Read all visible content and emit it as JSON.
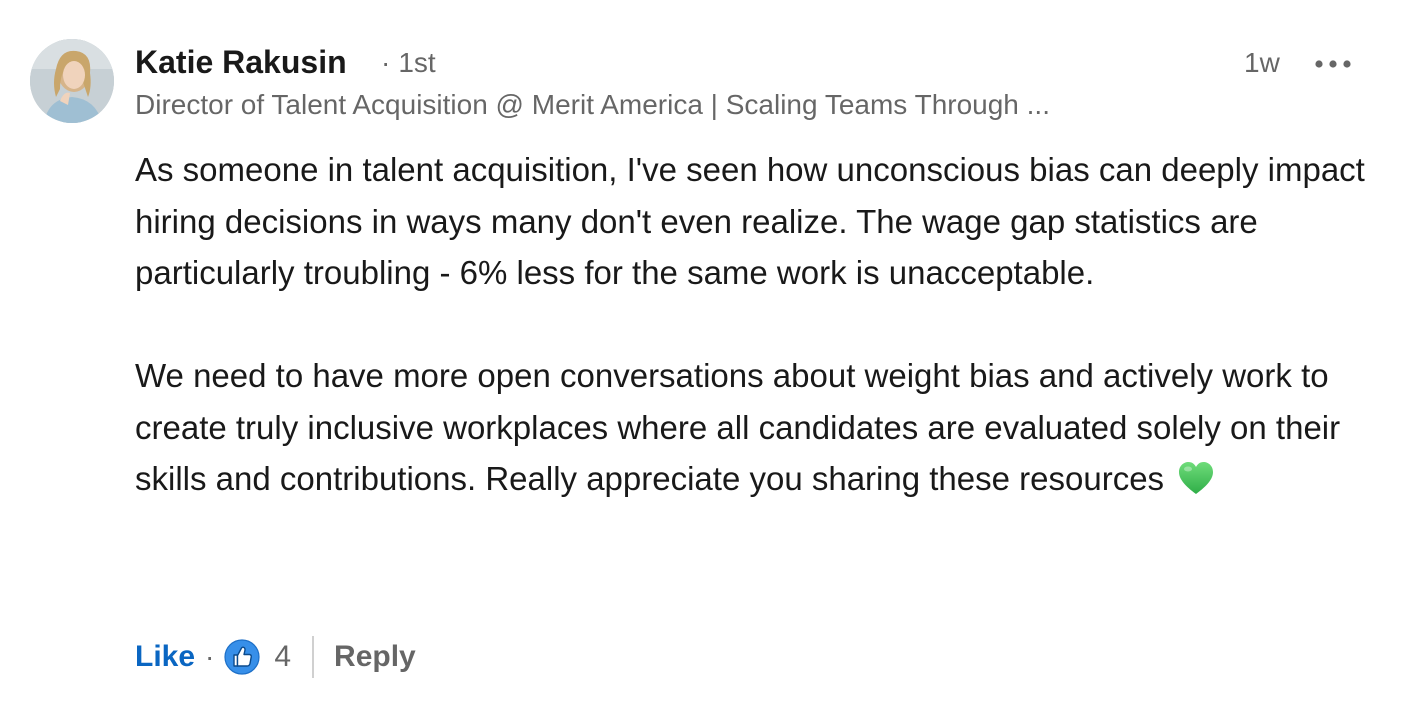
{
  "comment": {
    "author": {
      "name": "Katie Rakusin",
      "connection_degree": "1st",
      "separator": "·",
      "headline": "Director of Talent Acquisition @ Merit America | Scaling Teams Through ..."
    },
    "timestamp": "1w",
    "more_icon": "ellipsis-icon",
    "paragraphs": [
      "As someone in talent acquisition, I've seen how unconscious bias can deeply impact hiring decisions in ways many don't even realize. The wage gap statistics are particularly troubling - 6% less for the same work is unacceptable.",
      "We need to have more open conversations about weight bias and actively work to create truly inclusive workplaces where all candidates are evaluated solely on their skills and contributions. Really appreciate you sharing these resources"
    ],
    "emoji": "green-heart-icon",
    "actions": {
      "like_label": "Like",
      "separator": "·",
      "reaction_icon": "thumbs-up-icon",
      "reaction_count": "4",
      "reply_label": "Reply"
    }
  },
  "colors": {
    "like_blue": "#0a66c2",
    "secondary_text": "#666666",
    "heart_green": "#3dbd5a"
  }
}
